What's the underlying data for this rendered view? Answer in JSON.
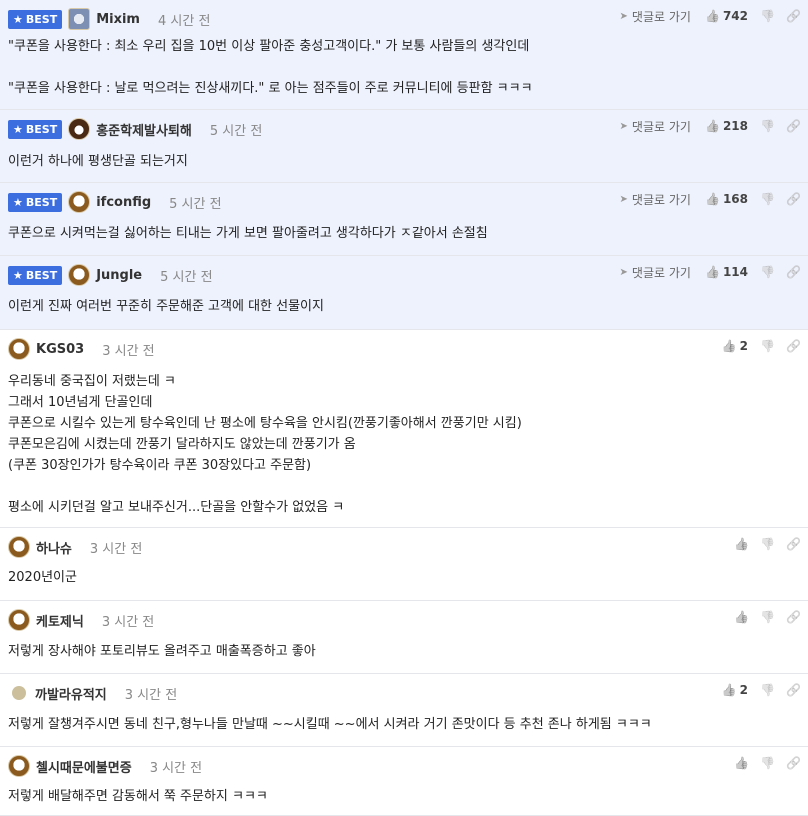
{
  "labels": {
    "best": "BEST",
    "reply_to": "댓글로 가기"
  },
  "icons": {
    "star": "star-icon",
    "thumb": "thumbs-up-icon",
    "dislike": "thumbs-down-icon",
    "link": "link-icon",
    "reply_arrow": "reply-arrow-icon"
  },
  "colors": {
    "best_badge": "#3d6ee0",
    "best_background": "#eef2fc"
  },
  "comments": [
    {
      "best": true,
      "nick": "Mixim",
      "time": "4 시간 전",
      "likes": "742",
      "lines": [
        "\"쿠폰을 사용한다 : 최소 우리 집을 10번 이상 팔아준 충성고객이다.\" 가 보통 사람들의 생각인데",
        "",
        "\"쿠폰을 사용한다 : 날로 먹으려는 진상새끼다.\" 로 아는 점주들이 주로 커뮤니티에 등판함 ㅋㅋㅋ"
      ]
    },
    {
      "best": true,
      "nick": "홍준학제발사퇴해",
      "time": "5 시간 전",
      "likes": "218",
      "lines": [
        "이런거 하나에 평생단골 되는거지"
      ]
    },
    {
      "best": true,
      "nick": "ifconfig",
      "time": "5 시간 전",
      "likes": "168",
      "lines": [
        "쿠폰으로 시켜먹는걸 싫어하는 티내는 가게 보면 팔아줄려고 생각하다가 ㅈ같아서 손절침"
      ]
    },
    {
      "best": true,
      "nick": "Jungle",
      "time": "5 시간 전",
      "likes": "114",
      "lines": [
        "이런게 진짜 여러번 꾸준히 주문해준 고객에 대한 선물이지"
      ]
    },
    {
      "best": false,
      "nick": "KGS03",
      "time": "3 시간 전",
      "likes": "2",
      "lines": [
        "우리동네 중국집이 저랬는데 ㅋ",
        "그래서 10년넘게 단골인데",
        "쿠폰으로 시킬수 있는게 탕수육인데 난 평소에 탕수육을 안시킴(깐풍기좋아해서 깐풍기만 시킴)",
        "쿠폰모은김에 시켰는데 깐풍기 달라하지도 않았는데 깐풍기가 옴",
        "(쿠폰 30장인가가 탕수육이라 쿠폰 30장있다고 주문함)",
        "",
        "평소에 시키던걸 알고 보내주신거...단골을 안할수가 없었음 ㅋ"
      ]
    },
    {
      "best": false,
      "nick": "하나슈",
      "time": "3 시간 전",
      "likes": "",
      "lines": [
        "2020년이군"
      ]
    },
    {
      "best": false,
      "nick": "케토제닉",
      "time": "3 시간 전",
      "likes": "",
      "lines": [
        "저렇게 장사해야 포토리뷰도 올려주고 매출폭증하고 좋아"
      ]
    },
    {
      "best": false,
      "nick": "까발라유적지",
      "time": "3 시간 전",
      "likes": "2",
      "lines": [
        "저렇게 잘챙겨주시면 동네 친구,형누나들 만날때 ~~시킬때 ~~에서 시켜라 거기 존맛이다 등 추천 존나 하게됨 ㅋㅋㅋ"
      ]
    },
    {
      "best": false,
      "nick": "첼시때문에불면증",
      "time": "3 시간 전",
      "likes": "",
      "lines": [
        "저렇게 배달해주면 감동해서 쭉 주문하지 ㅋㅋㅋ"
      ]
    }
  ]
}
